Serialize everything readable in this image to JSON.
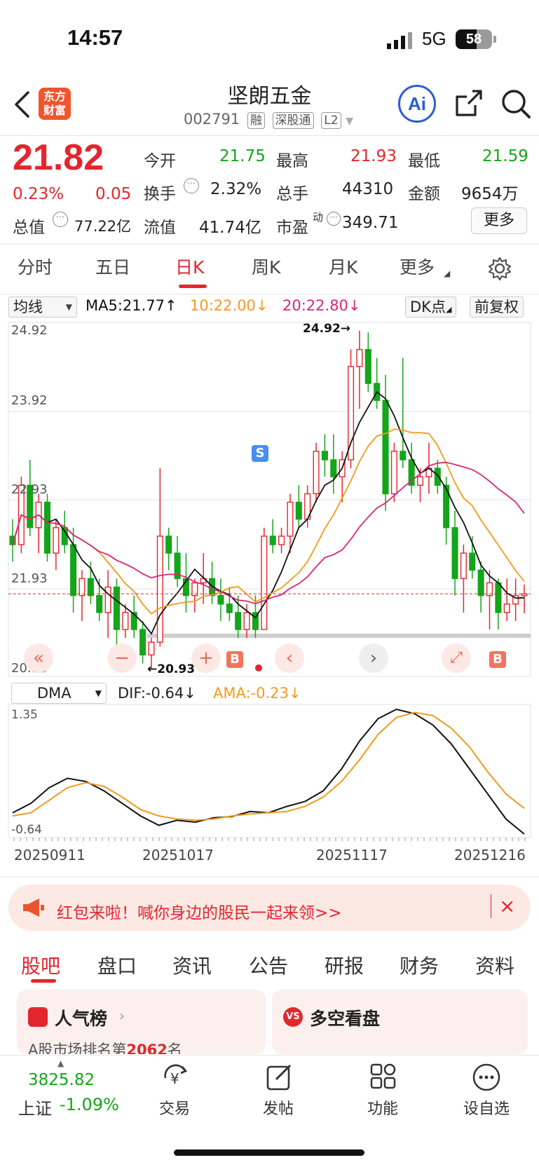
{
  "status_bar": {
    "time": "14:57",
    "network": "5G",
    "battery": "58"
  },
  "header": {
    "logo_text": "东方财富",
    "stock_name": "坚朗五金",
    "stock_code": "002791",
    "tags": [
      "融",
      "深股通",
      "L2"
    ],
    "ai_label": "Ai"
  },
  "quote": {
    "price": "21.82",
    "change_pct": "0.23%",
    "change": "0.05",
    "open_label": "今开",
    "open": "21.75",
    "high_label": "最高",
    "high": "21.93",
    "low_label": "最低",
    "low": "21.59",
    "turnover_label": "换手",
    "turnover": "2.32%",
    "volume_label": "总手",
    "volume": "44310",
    "amount_label": "金额",
    "amount": "9654万",
    "total_cap_label": "总值",
    "total_cap": "77.22亿",
    "float_cap_label": "流值",
    "float_cap": "41.74亿",
    "pe_label": "市盈",
    "pe_sup": "动",
    "pe": "349.71",
    "more_label": "更多"
  },
  "period_tabs": [
    "分时",
    "五日",
    "日K",
    "周K",
    "月K",
    "更多"
  ],
  "active_period": "日K",
  "indicator_bar": {
    "selector": "均线",
    "ma5": "MA5:21.77↑",
    "ma10": "10:22.00↓",
    "ma20": "20:22.80↓",
    "dk_label": "DK点",
    "adjust_label": "前复权"
  },
  "colors": {
    "up": "#e3262e",
    "down": "#14a51a",
    "ma5": "#111111",
    "ma10": "#f39a1e",
    "ma20": "#d6277a",
    "ama": "#f39a1e",
    "accent": "#e3262e"
  },
  "kline": {
    "y_labels": [
      "24.92",
      "23.92",
      "22.93",
      "21.93",
      "20.93"
    ],
    "high_marker": "24.92→",
    "low_marker": "←20.93",
    "signals": [
      "S",
      "B",
      "B",
      "B"
    ]
  },
  "chart_data": [
    {
      "type": "candlestick",
      "title": "",
      "ylim": [
        20.93,
        24.92
      ],
      "ma": {
        "MA5": 21.77,
        "MA10": 22.0,
        "MA20": 22.8
      },
      "candles": [
        [
          22.5,
          22.7,
          22.2,
          22.4
        ],
        [
          22.4,
          23.2,
          22.3,
          23.1
        ],
        [
          23.1,
          23.4,
          22.5,
          22.6
        ],
        [
          22.6,
          23.0,
          22.3,
          22.9
        ],
        [
          22.9,
          23.0,
          22.2,
          22.3
        ],
        [
          22.3,
          22.7,
          22.1,
          22.6
        ],
        [
          22.6,
          22.8,
          22.3,
          22.4
        ],
        [
          22.4,
          22.6,
          21.6,
          21.8
        ],
        [
          21.8,
          22.1,
          21.5,
          22.0
        ],
        [
          22.0,
          22.2,
          21.7,
          21.8
        ],
        [
          21.8,
          22.0,
          21.5,
          21.6
        ],
        [
          21.6,
          22.1,
          21.3,
          21.9
        ],
        [
          21.9,
          22.0,
          21.2,
          21.4
        ],
        [
          21.4,
          21.7,
          21.3,
          21.6
        ],
        [
          21.6,
          21.8,
          21.3,
          21.4
        ],
        [
          21.4,
          21.5,
          21.0,
          21.1
        ],
        [
          21.1,
          21.3,
          20.93,
          21.25
        ],
        [
          21.25,
          23.3,
          21.2,
          22.5
        ],
        [
          22.5,
          22.6,
          22.1,
          22.3
        ],
        [
          22.3,
          22.5,
          21.9,
          22.0
        ],
        [
          22.0,
          22.3,
          21.6,
          21.8
        ],
        [
          21.8,
          22.0,
          21.6,
          21.95
        ],
        [
          21.95,
          22.3,
          21.7,
          22.0
        ],
        [
          22.0,
          22.2,
          21.7,
          21.8
        ],
        [
          21.8,
          22.0,
          21.5,
          21.7
        ],
        [
          21.7,
          21.9,
          21.5,
          21.6
        ],
        [
          21.6,
          21.8,
          21.3,
          21.4
        ],
        [
          21.4,
          21.7,
          21.3,
          21.6
        ],
        [
          21.6,
          21.8,
          21.3,
          21.4
        ],
        [
          21.4,
          22.6,
          21.4,
          22.5
        ],
        [
          22.5,
          22.7,
          22.3,
          22.4
        ],
        [
          22.4,
          22.6,
          22.3,
          22.5
        ],
        [
          22.5,
          23.0,
          22.3,
          22.9
        ],
        [
          22.9,
          23.1,
          22.6,
          22.7
        ],
        [
          22.7,
          23.1,
          22.6,
          23.0
        ],
        [
          23.0,
          23.6,
          22.9,
          23.5
        ],
        [
          23.5,
          23.7,
          23.2,
          23.4
        ],
        [
          23.4,
          23.7,
          23.0,
          23.2
        ],
        [
          23.2,
          23.5,
          22.9,
          23.4
        ],
        [
          23.4,
          24.7,
          23.3,
          24.5
        ],
        [
          24.5,
          24.92,
          24.0,
          24.7
        ],
        [
          24.7,
          24.9,
          24.2,
          24.3
        ],
        [
          24.3,
          24.6,
          24.0,
          24.1
        ],
        [
          24.1,
          24.4,
          22.8,
          23.0
        ],
        [
          23.0,
          23.6,
          22.9,
          23.5
        ],
        [
          23.5,
          24.6,
          23.3,
          23.4
        ],
        [
          23.4,
          23.6,
          23.0,
          23.1
        ],
        [
          23.1,
          23.3,
          22.9,
          23.2
        ],
        [
          23.2,
          23.6,
          23.0,
          23.3
        ],
        [
          23.3,
          23.4,
          23.0,
          23.1
        ],
        [
          23.1,
          23.2,
          22.4,
          22.6
        ],
        [
          22.6,
          22.8,
          21.8,
          22.0
        ],
        [
          22.0,
          22.4,
          21.6,
          22.3
        ],
        [
          22.3,
          22.5,
          22.0,
          22.1
        ],
        [
          22.1,
          22.2,
          21.6,
          21.8
        ],
        [
          21.8,
          22.1,
          21.4,
          21.95
        ],
        [
          21.95,
          22.0,
          21.4,
          21.6
        ],
        [
          21.6,
          22.0,
          21.5,
          21.7
        ],
        [
          21.7,
          22.0,
          21.5,
          21.8
        ],
        [
          21.8,
          21.93,
          21.59,
          21.82
        ]
      ]
    },
    {
      "type": "line",
      "title": "",
      "ylim": [
        -0.64,
        1.35
      ],
      "indicator": "DMA",
      "y_labels": [
        "1.35",
        "-0.64"
      ],
      "x_labels": [
        "20250911",
        "20251017",
        "20251117",
        "20251216"
      ],
      "series": [
        {
          "name": "DIF",
          "current": "DIF:-0.64↓",
          "values": [
            -0.3,
            -0.15,
            0.1,
            0.25,
            0.2,
            0.05,
            -0.15,
            -0.35,
            -0.5,
            -0.42,
            -0.45,
            -0.38,
            -0.36,
            -0.28,
            -0.3,
            -0.2,
            -0.12,
            0.05,
            0.4,
            0.85,
            1.2,
            1.35,
            1.28,
            1.1,
            0.8,
            0.4,
            0.0,
            -0.4,
            -0.64
          ]
        },
        {
          "name": "AMA",
          "current": "AMA:-0.23↓",
          "values": [
            -0.35,
            -0.3,
            -0.1,
            0.1,
            0.18,
            0.12,
            -0.05,
            -0.25,
            -0.35,
            -0.4,
            -0.42,
            -0.4,
            -0.35,
            -0.32,
            -0.3,
            -0.28,
            -0.2,
            -0.05,
            0.2,
            0.55,
            0.95,
            1.22,
            1.3,
            1.25,
            1.05,
            0.75,
            0.35,
            0.0,
            -0.23
          ]
        }
      ]
    }
  ],
  "control_buttons": [
    "«",
    "−",
    "+",
    "‹",
    "›",
    "⤢"
  ],
  "banner": {
    "text": "红包来啦！喊你身边的股民一起来领>>",
    "close": "×"
  },
  "bottom_tabs": [
    "股吧",
    "盘口",
    "资讯",
    "公告",
    "研报",
    "财务",
    "资料"
  ],
  "active_bottom_tab": "股吧",
  "cards": [
    {
      "title": "人气榜",
      "subtitle_prefix": "A股市场排名第",
      "rank": "2062",
      "subtitle_suffix": "名"
    },
    {
      "title": "多空看盘"
    }
  ],
  "index_widget": {
    "value": "3825.82",
    "name": "上证",
    "change": "-1.09%"
  },
  "nav": [
    {
      "icon": "yen-cycle-icon",
      "label": "交易"
    },
    {
      "icon": "edit-icon",
      "label": "发帖"
    },
    {
      "icon": "grid-icon",
      "label": "功能"
    },
    {
      "icon": "more-dots-icon",
      "label": "设自选"
    }
  ]
}
